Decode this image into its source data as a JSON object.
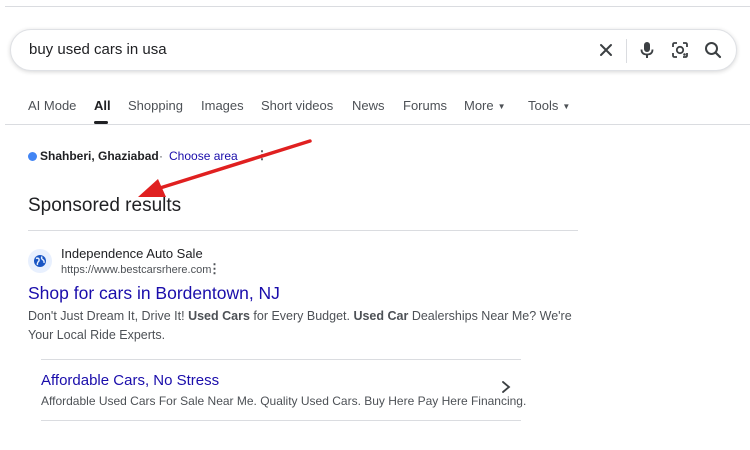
{
  "search": {
    "query": "buy used cars in usa"
  },
  "icons": {
    "clear": "close-icon",
    "voice": "microphone-icon",
    "lens": "camera-lens-icon",
    "search": "search-icon",
    "menu": "more-vert-icon",
    "favicon": "globe-icon",
    "chevron": "chevron-right-icon"
  },
  "tabs": [
    {
      "label": "AI Mode",
      "active": false
    },
    {
      "label": "All",
      "active": true
    },
    {
      "label": "Shopping",
      "active": false
    },
    {
      "label": "Images",
      "active": false
    },
    {
      "label": "Short videos",
      "active": false
    },
    {
      "label": "News",
      "active": false
    },
    {
      "label": "Forums",
      "active": false
    },
    {
      "label": "More",
      "active": false,
      "dropdown": true
    },
    {
      "label": "Tools",
      "active": false,
      "dropdown": true
    }
  ],
  "location": {
    "name": "Shahberi, Ghaziabad",
    "separator": "·",
    "action": "Choose area"
  },
  "sponsored_heading": "Sponsored results",
  "ad": {
    "advertiser": "Independence Auto Sale",
    "url": "https://www.bestcarsrhere.com",
    "title": "Shop for cars in Bordentown, NJ",
    "desc_1": "Don't Just Dream It, Drive It! ",
    "desc_bold_1": "Used Cars",
    "desc_2": " for Every Budget. ",
    "desc_bold_2": "Used Car",
    "desc_3": " Dealerships Near Me? We're Your Local Ride Experts."
  },
  "sitelink": {
    "title": "Affordable Cars, No Stress",
    "description": "Affordable Used Cars For Sale Near Me. Quality Used Cars. Buy Here Pay Here Financing."
  },
  "colors": {
    "link": "#1a0dab",
    "location_dot": "#4285f4",
    "annotation_arrow": "#e02020"
  }
}
